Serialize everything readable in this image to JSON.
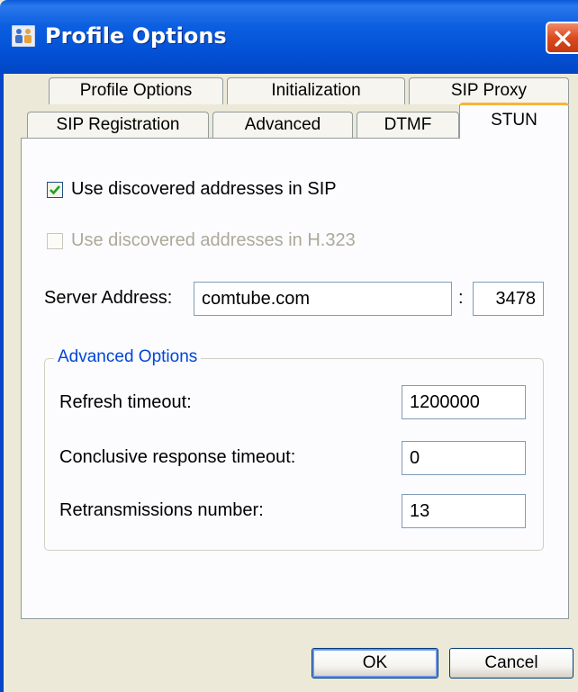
{
  "window": {
    "title": "Profile Options"
  },
  "tabs_back": [
    "Profile Options",
    "Initialization",
    "SIP Proxy"
  ],
  "tabs_front": [
    "SIP Registration",
    "Advanced",
    "DTMF",
    "STUN"
  ],
  "active_tab": "STUN",
  "stun": {
    "use_sip": {
      "label": "Use discovered addresses in SIP",
      "checked": true
    },
    "use_h323": {
      "label": "Use discovered addresses in H.323",
      "checked": false,
      "disabled": true
    },
    "server_address_label": "Server Address:",
    "server_address_value": "comtube.com",
    "port_separator": ":",
    "port_value": "3478",
    "advanced_group_title": "Advanced Options",
    "refresh_timeout_label": "Refresh timeout:",
    "refresh_timeout_value": "1200000",
    "conclusive_timeout_label": "Conclusive response timeout:",
    "conclusive_timeout_value": "0",
    "retransmissions_label": "Retransmissions number:",
    "retransmissions_value": "13"
  },
  "buttons": {
    "ok": "OK",
    "cancel": "Cancel"
  },
  "icons": {
    "app": "profile-options-icon",
    "close": "close-icon",
    "check": "checkmark-icon"
  },
  "colors": {
    "titlebar": "#0351d6",
    "group_title": "#0046d5",
    "active_tab_accent": "#f7b43a",
    "close_button": "#dc4a1f"
  }
}
